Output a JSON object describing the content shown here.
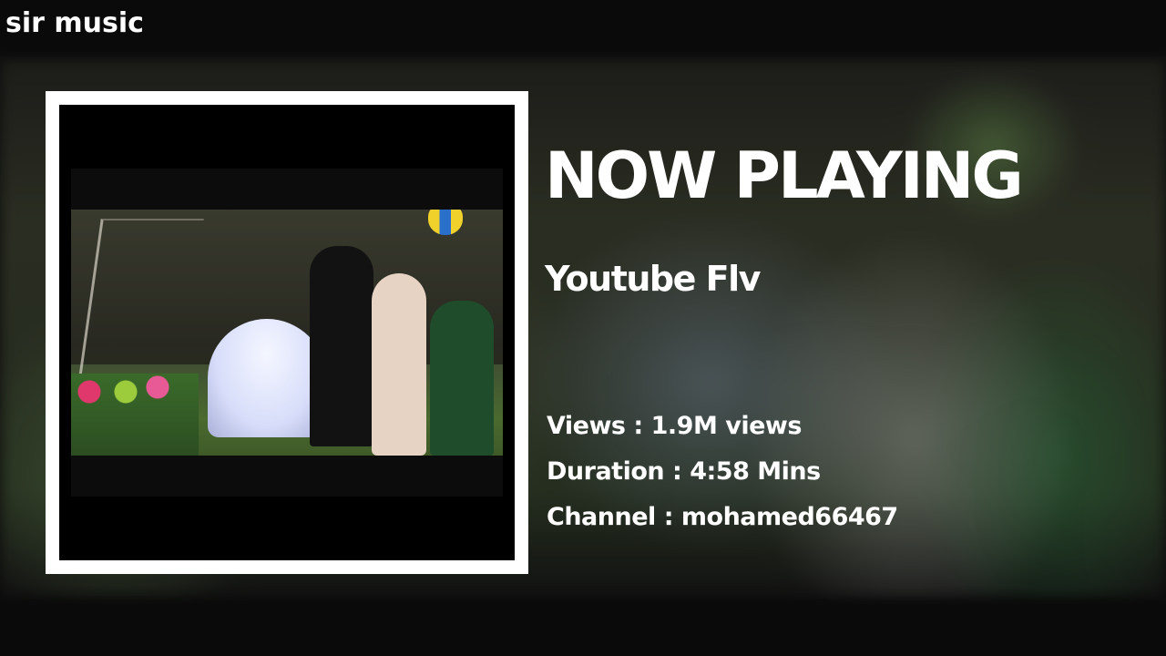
{
  "header": {
    "brand": "sir music"
  },
  "now_playing": {
    "heading": "NOW PLAYING",
    "title": "Youtube Flv",
    "views_label": "Views",
    "views_value": "1.9M views",
    "duration_label": "Duration",
    "duration_value": "4:58 Mins",
    "channel_label": "Channel",
    "channel_value": "mohamed66467"
  },
  "colors": {
    "text": "#ffffff",
    "frame": "#ffffff",
    "background": "#0b0b0b"
  }
}
